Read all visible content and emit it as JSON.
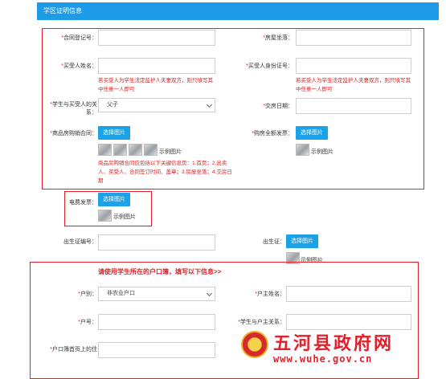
{
  "header": {
    "title": "学区证明信息"
  },
  "fields": {
    "contract_no": "*合同登记号：",
    "room_location": "*房屋坐落：",
    "buyer_name": "*买受人姓名：",
    "buyer_id": "*买受人身份证号：",
    "relation": "*学生与买受人的关系：",
    "relation_value": "父子",
    "handover_date": "*交房日期：",
    "commodity_contract": "*商品房购销合同：",
    "full_invoice": "*购房全额发票：",
    "electricity_invoice": "电费发票：",
    "birth_cert_no": "出生证编号：",
    "birth_cert": "出生证：",
    "household_type": "*户别：",
    "household_type_value": "非农业户口",
    "householder_name": "*户主姓名：",
    "household_no": "*户号：",
    "student_householder_relation": "*学生与户主关系：",
    "household_address": "*户口簿首页上的住"
  },
  "notes": {
    "buyer_name_note": "若买受人为学生法定监护人夫妻双方，则只填写其中任意一人即可",
    "buyer_id_note": "若买受人为学生法定监护人夫妻双方，则只填写其中任意一人即可",
    "contract_note": "商品房购销合同应包括以下关键信息页：1.首页；2.出卖人、买受人、合同签订时间、盖章；3.房屋坐落；4.交房日期"
  },
  "buttons": {
    "choose_image": "选择图片"
  },
  "sample_label": "示例图片",
  "household_prompt": "请使用学生所在的户口簿，填写以下信息>>",
  "watermark": {
    "title": "五河县政府网",
    "url": "www.wuhe.gov.cn"
  },
  "colors": {
    "header": "#1e9be8",
    "accent_red": "#e0202a",
    "button": "#1aa3e8"
  }
}
